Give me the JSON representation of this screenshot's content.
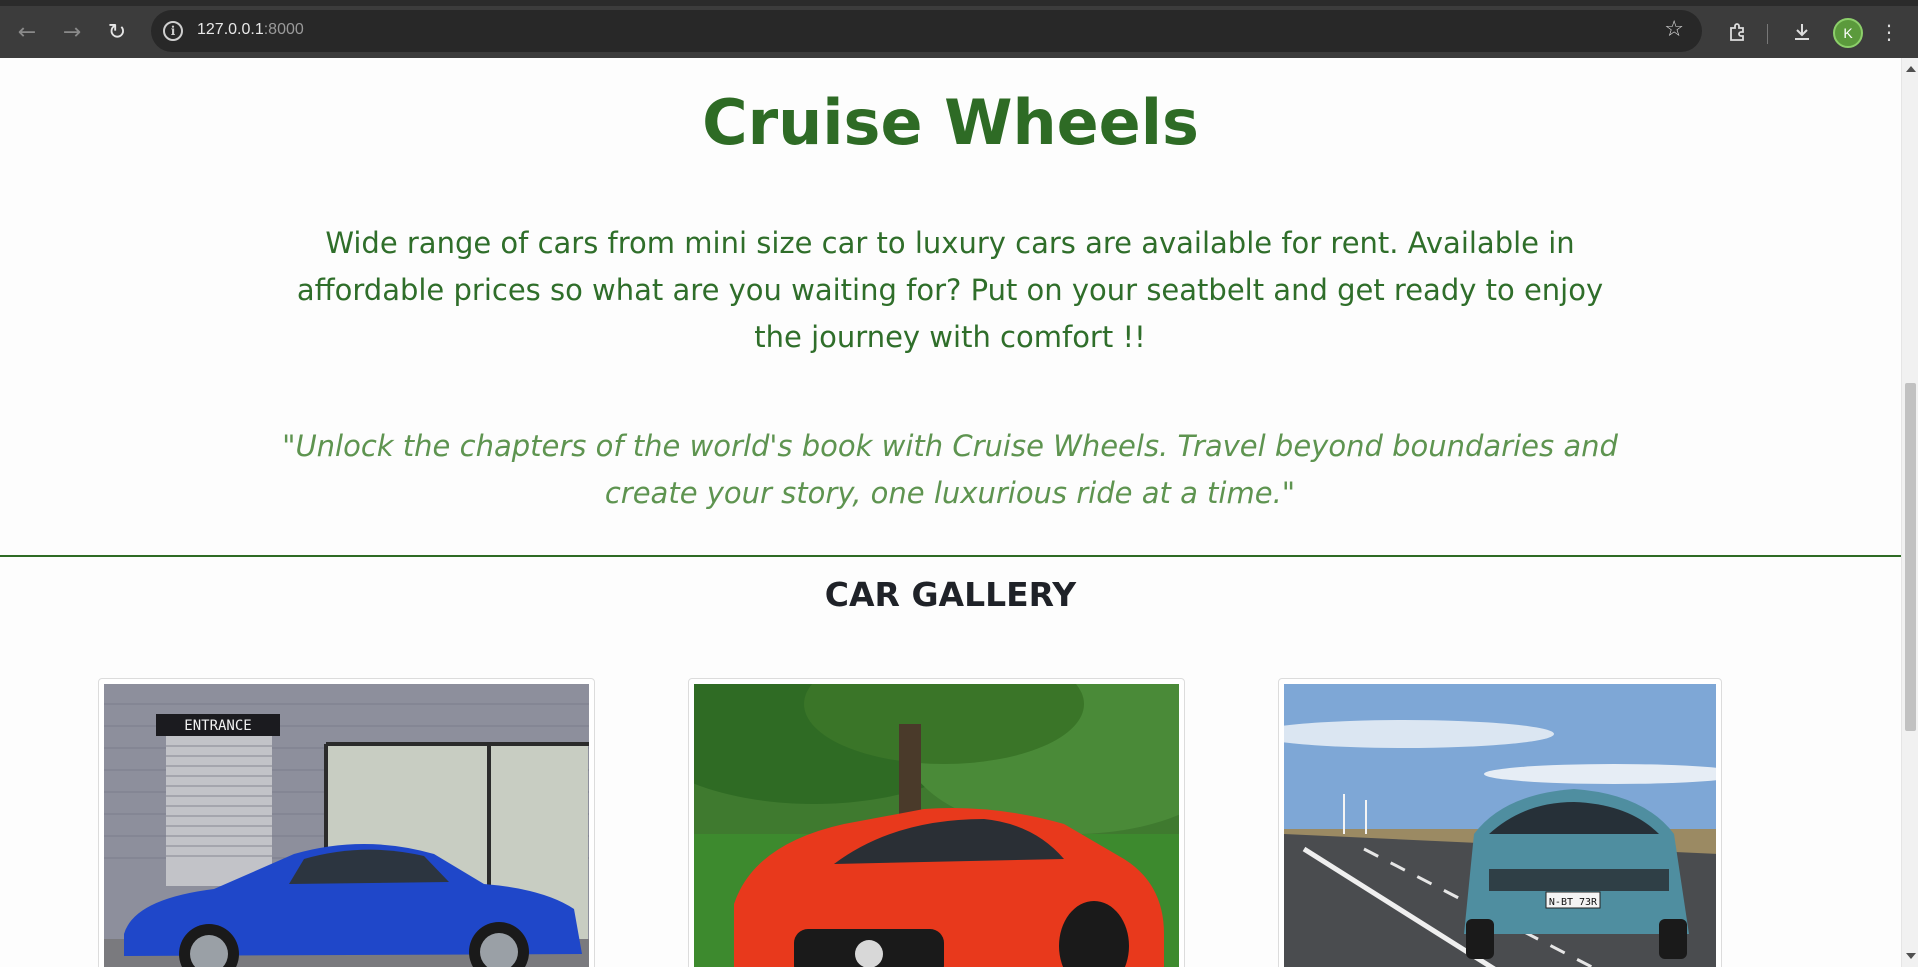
{
  "browser": {
    "url_host": "127.0.0.1",
    "url_port": ":8000",
    "profile_initial": "K",
    "icons": [
      "back-icon",
      "forward-icon",
      "reload-icon",
      "site-info-icon",
      "bookmark-star-icon",
      "extensions-icon",
      "download-icon",
      "menu-icon"
    ]
  },
  "hero": {
    "title": "Cruise Wheels",
    "description": "Wide range of cars from mini size car to luxury cars are available for rent. Available in affordable prices so what are you waiting for? Put on your seatbelt and get ready to enjoy the journey with comfort !!",
    "quote": "\"Unlock the chapters of the world's book with Cruise Wheels. Travel beyond boundaries and create your story, one luxurious ride at a time.\""
  },
  "gallery": {
    "title": "CAR GALLERY",
    "cards": [
      {
        "sign_text": "ENTRANCE",
        "car_color": "#1f47c9"
      },
      {
        "car_color": "#e8391c"
      },
      {
        "plate_text": "N-BT 73R",
        "car_color": "#4f8ea0"
      }
    ]
  },
  "colors": {
    "brand_green": "#2e6b25",
    "quote_green": "#5e9450",
    "heading_dark": "#1f2228"
  }
}
